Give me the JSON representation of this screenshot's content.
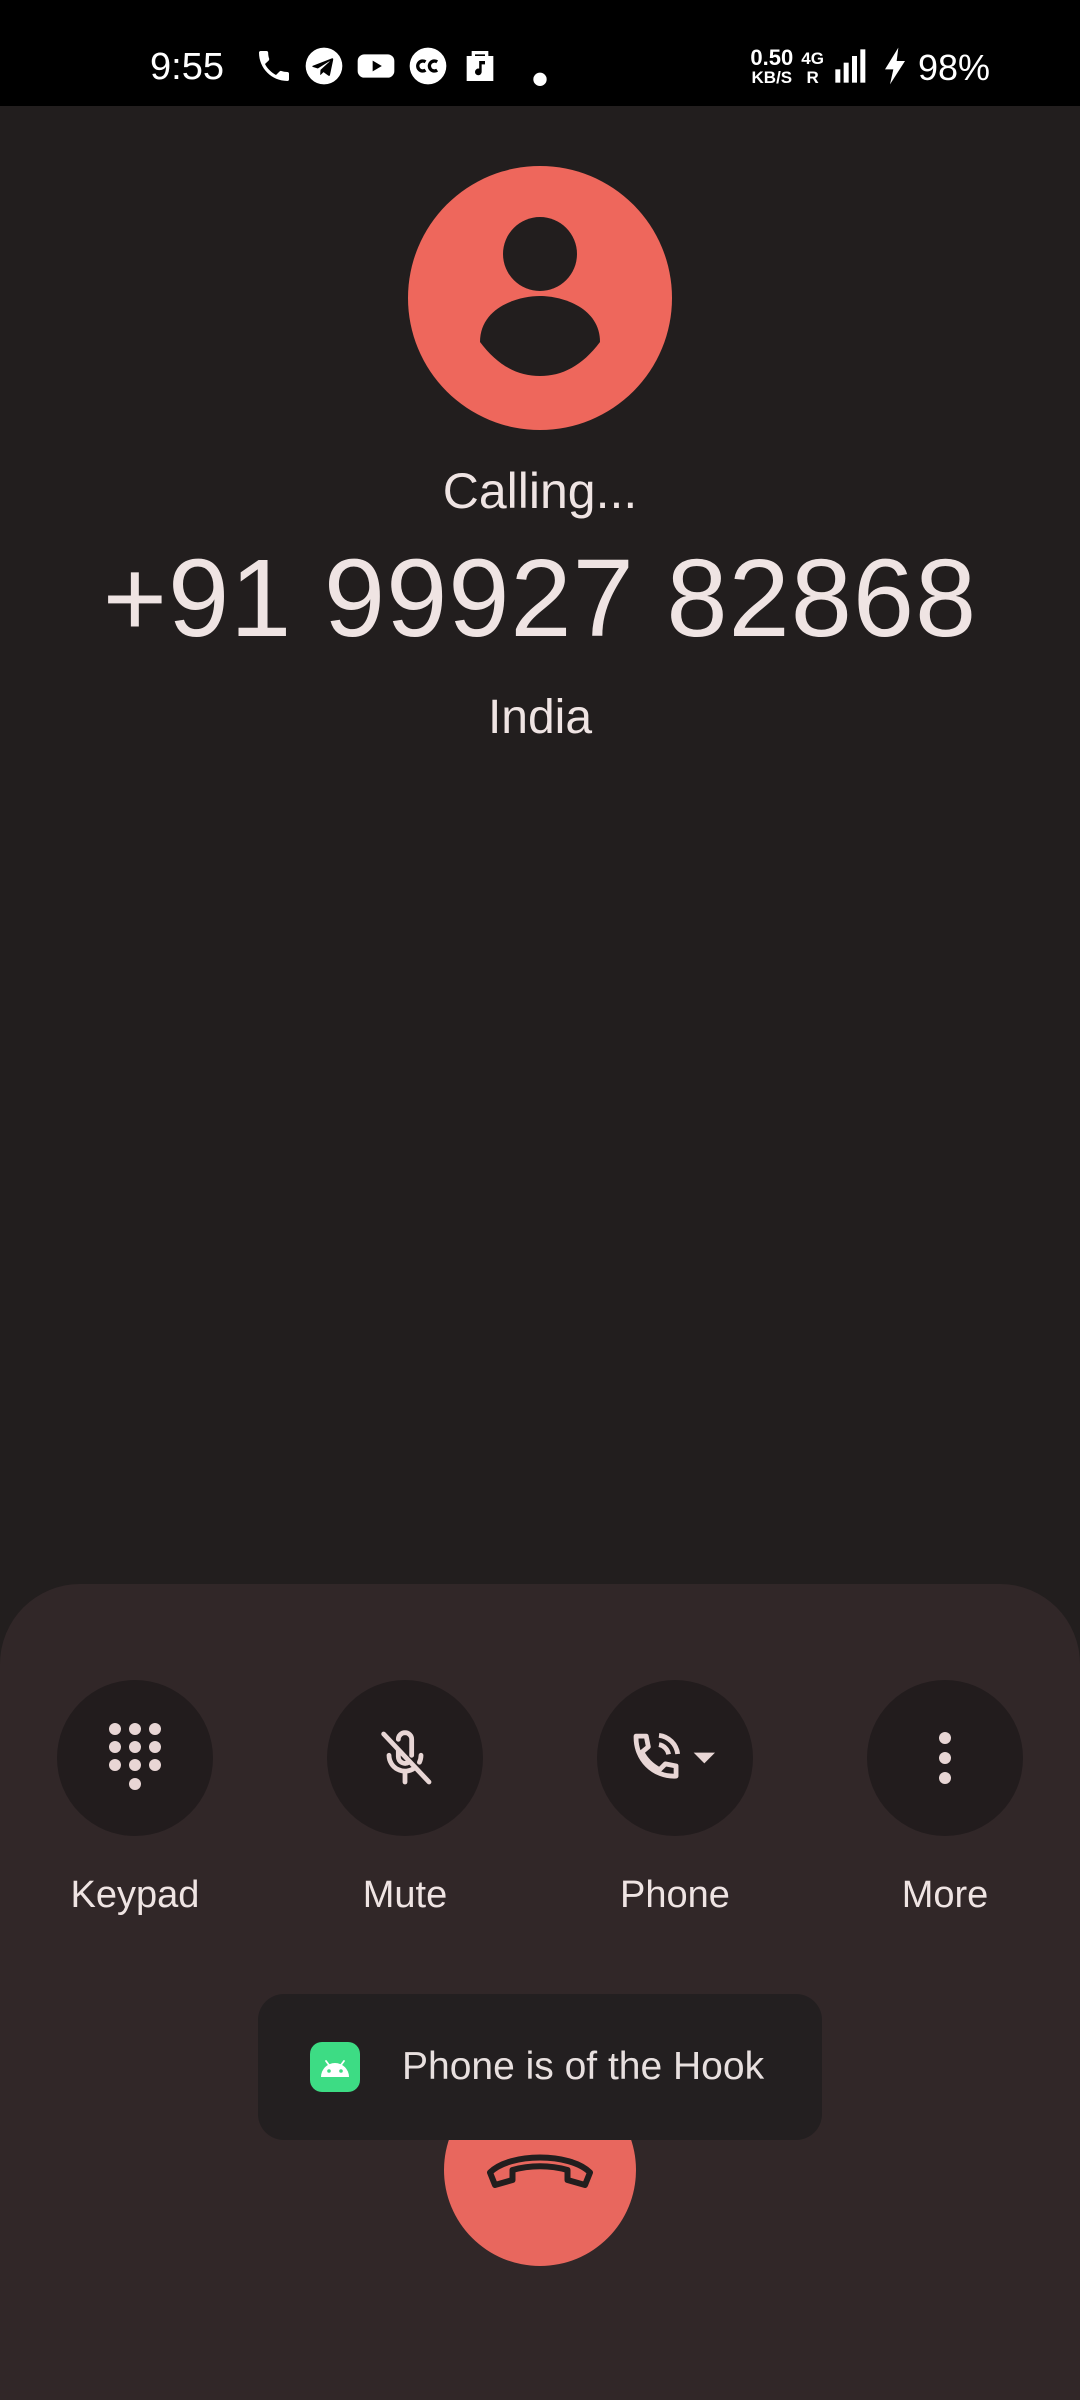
{
  "status_bar": {
    "time": "9:55",
    "icons": [
      "phone-icon",
      "telegram-icon",
      "youtube-icon",
      "closed-caption-icon",
      "shopping-bag-icon",
      "dot-icon"
    ],
    "net_speed_value": "0.50",
    "net_speed_unit": "KB/S",
    "net_type_top": "4G",
    "net_type_bottom": "R",
    "battery_percent": "98%"
  },
  "call": {
    "status": "Calling...",
    "number": "+91 99927 82868",
    "location": "India"
  },
  "controls": [
    {
      "label": "Keypad",
      "icon": "dialpad-icon"
    },
    {
      "label": "Mute",
      "icon": "mic-off-icon"
    },
    {
      "label": "Phone",
      "icon": "phone-audio-route-icon"
    },
    {
      "label": "More",
      "icon": "more-vert-icon"
    }
  ],
  "toast": {
    "message": "Phone is of the Hook",
    "icon": "android-app-icon"
  },
  "colors": {
    "background": "#221e1e",
    "sheet": "#312728",
    "accent": "#ee675c",
    "text": "#efe4e3"
  }
}
